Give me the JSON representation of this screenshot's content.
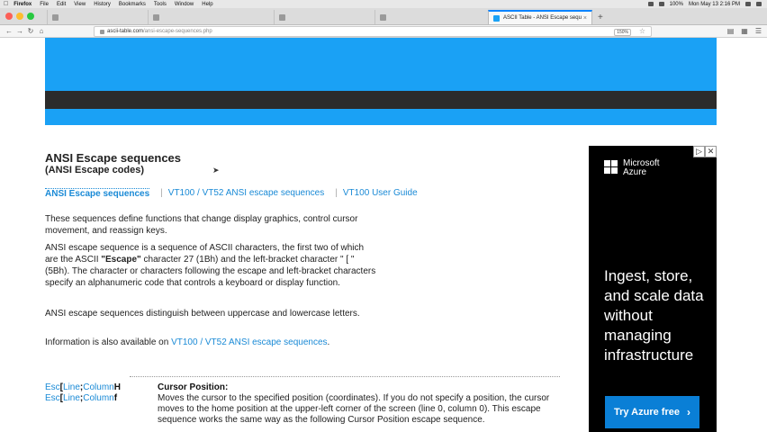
{
  "menubar": {
    "app": "Firefox",
    "items": [
      "File",
      "Edit",
      "View",
      "History",
      "Bookmarks",
      "Tools",
      "Window",
      "Help"
    ],
    "battery": "100%",
    "clock": "Mon May 13  2:16 PM"
  },
  "tabs": [
    {
      "label": "",
      "active": false
    },
    {
      "label": "",
      "active": false
    },
    {
      "label": "",
      "active": false
    },
    {
      "label": "",
      "active": false
    },
    {
      "label": "ASCII Table - ANSI Escape sequ",
      "active": true
    }
  ],
  "url": {
    "domain": "ascii-table.com",
    "path": "/ansi-escape-sequences.php",
    "zoom": "150%"
  },
  "article": {
    "title": "ANSI Escape sequences",
    "subtitle": "(ANSI Escape codes)",
    "subnav": {
      "current": "ANSI Escape sequences",
      "link1": "VT100 / VT52 ANSI escape sequences",
      "link2": "VT100 User Guide"
    },
    "p1": "These sequences define functions that change display graphics, control cursor movement, and reassign keys.",
    "p2_a": "ANSI escape sequence is a sequence of ASCII characters, the first two of which are the ASCII ",
    "p2_b": "\"Escape\"",
    "p2_c": " character 27 (1Bh) and the left-bracket character \" [ \" (5Bh). The character or characters following the escape and left-bracket characters specify an alphanumeric code that controls a keyboard or display function.",
    "p3": "ANSI escape sequences distinguish between uppercase and lowercase letters.",
    "p4_a": "Information is also available on ",
    "p4_link": "VT100 / VT52 ANSI escape sequences",
    "p4_b": "."
  },
  "escape_rows": [
    {
      "esc": "Esc",
      "bracket": "[",
      "line": "Line",
      "semi": ";",
      "column": "Column",
      "cmd": "H"
    },
    {
      "esc": "Esc",
      "bracket": "[",
      "line": "Line",
      "semi": ";",
      "column": "Column",
      "cmd": "f"
    }
  ],
  "cursor_position": {
    "title": "Cursor Position:",
    "text": "Moves the cursor to the specified position (coordinates). If you do not specify a position, the cursor moves to the home position at the upper-left corner of the screen (line 0, column 0). This escape sequence works the same way as the following Cursor Position escape sequence."
  },
  "ad": {
    "brand_line1": "Microsoft",
    "brand_line2": "Azure",
    "headline": "Ingest, store, and scale data without managing infrastructure",
    "button": "Try Azure free",
    "button_chevron": "›",
    "choice_icon": "▷",
    "close_icon": "✕"
  },
  "colors": {
    "header_blue": "#1aa1f5",
    "header_dark": "#2b2b2b",
    "link": "#1a8ad6",
    "ad_bg": "#000000",
    "ad_button": "#0a7fd6"
  }
}
